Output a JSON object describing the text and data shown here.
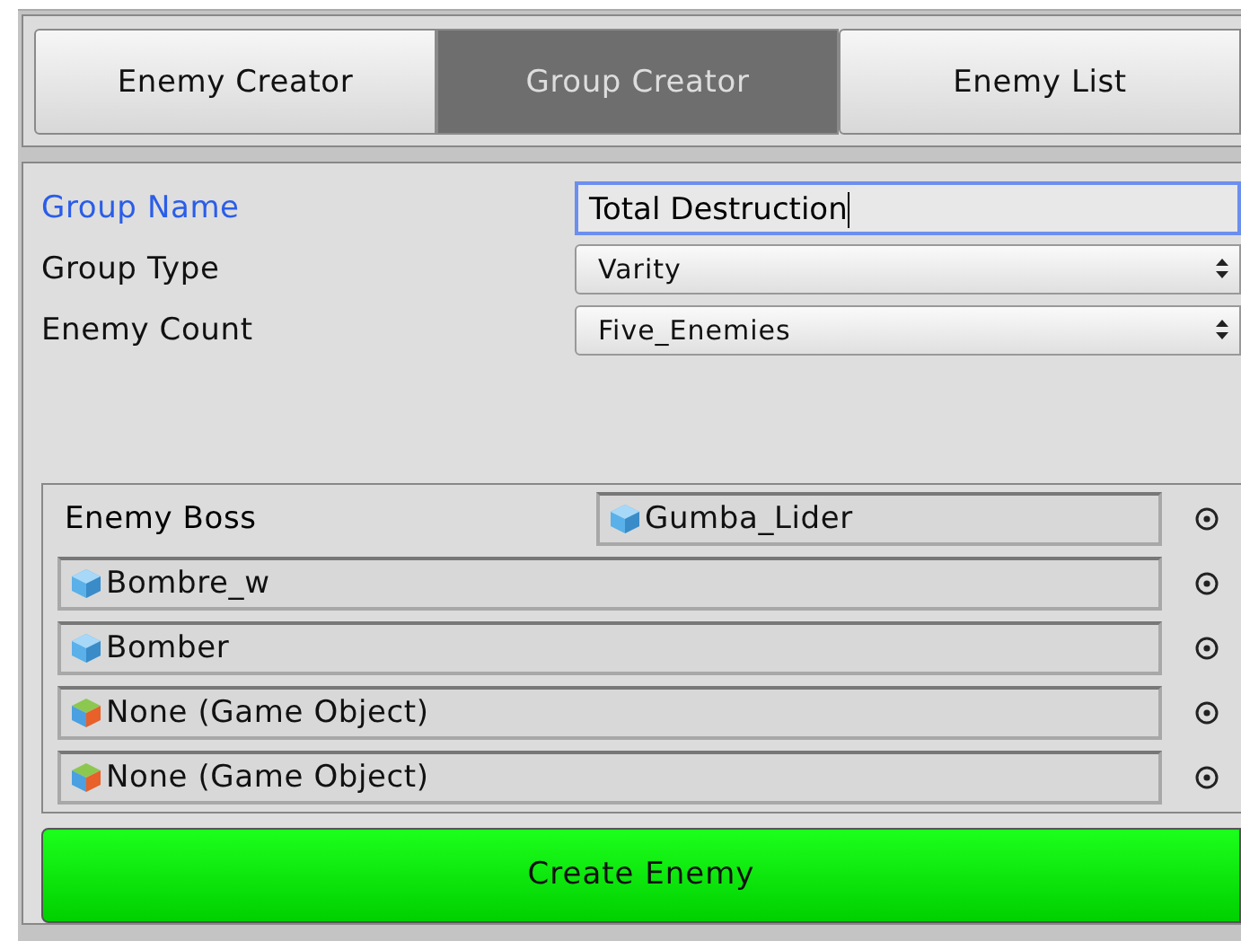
{
  "tabs": [
    {
      "label": "Enemy Creator",
      "selected": false
    },
    {
      "label": "Group Creator",
      "selected": true
    },
    {
      "label": "Enemy List",
      "selected": false
    }
  ],
  "fields": [
    {
      "kind": "text",
      "label": "Group Name",
      "value": "Total Destruction",
      "focused": true
    },
    {
      "kind": "dropdown",
      "label": "Group Type",
      "value": "Varity",
      "focused": false
    },
    {
      "kind": "dropdown",
      "label": "Enemy Count",
      "value": "Five_Enemies",
      "focused": false
    }
  ],
  "slots": [
    {
      "label": "Enemy Boss",
      "value": "Gumba_Lider",
      "kind": "prefab"
    },
    {
      "value": "Bombre_w",
      "kind": "prefab"
    },
    {
      "value": "Bomber",
      "kind": "prefab"
    },
    {
      "value": "None (Game Object)",
      "kind": "empty"
    },
    {
      "value": "None (Game Object)",
      "kind": "empty"
    }
  ],
  "button": "Create Enemy"
}
